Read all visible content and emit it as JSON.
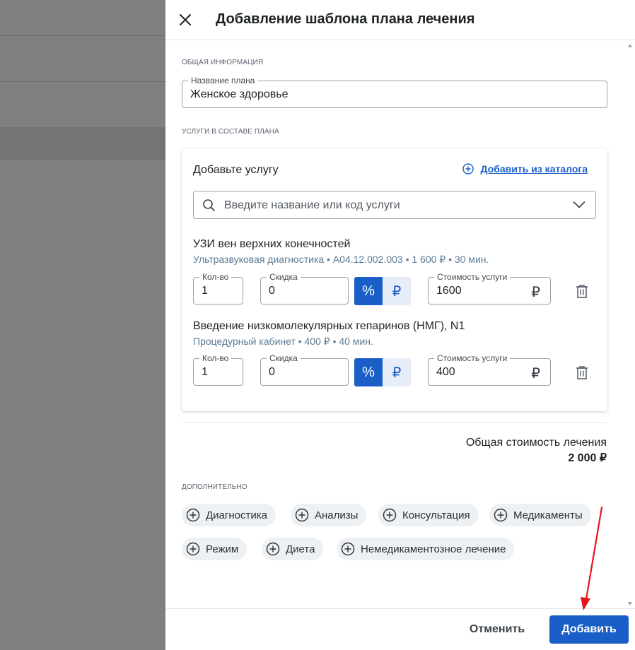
{
  "drawer": {
    "title": "Добавление шаблона плана лечения"
  },
  "general": {
    "section_label": "ОБЩАЯ ИНФОРМАЦИЯ",
    "plan_name_label": "Название плана",
    "plan_name_value": "Женское здоровье"
  },
  "services": {
    "section_label": "УСЛУГИ В СОСТАВЕ ПЛАНА",
    "add_heading": "Добавьте услугу",
    "catalog_link": "Добавить из каталога",
    "search_placeholder": "Введите название или код услуги",
    "items": [
      {
        "name": "УЗИ вен верхних конечностей",
        "meta": "Ультразвуковая диагностика • A04.12.002.003 • 1 600 ₽ • 30 мин.",
        "qty_label": "Кол-во",
        "qty": "1",
        "discount_label": "Скидка",
        "discount": "0",
        "percent_symbol": "%",
        "ruble_symbol": "₽",
        "discount_mode": "percent",
        "cost_label": "Стоимость услуги",
        "cost": "1600",
        "cost_currency": "₽"
      },
      {
        "name": "Введение низкомолекулярных гепаринов (НМГ), N1",
        "meta": "Процедурный кабинет • 400 ₽ • 40 мин.",
        "qty_label": "Кол-во",
        "qty": "1",
        "discount_label": "Скидка",
        "discount": "0",
        "percent_symbol": "%",
        "ruble_symbol": "₽",
        "discount_mode": "percent",
        "cost_label": "Стоимость услуги",
        "cost": "400",
        "cost_currency": "₽"
      }
    ]
  },
  "total": {
    "label": "Общая стоимость лечения",
    "value": "2 000 ₽"
  },
  "extra": {
    "section_label": "ДОПОЛНИТЕЛЬНО",
    "chips": [
      "Диагностика",
      "Анализы",
      "Консультация",
      "Медикаменты",
      "Режим",
      "Диета",
      "Немедикаментозное лечение"
    ]
  },
  "footer": {
    "cancel_label": "Отменить",
    "add_label": "Добавить"
  },
  "colors": {
    "accent": "#1a5fc8",
    "annotation_arrow": "#e8141c",
    "overlay": "#808080"
  }
}
